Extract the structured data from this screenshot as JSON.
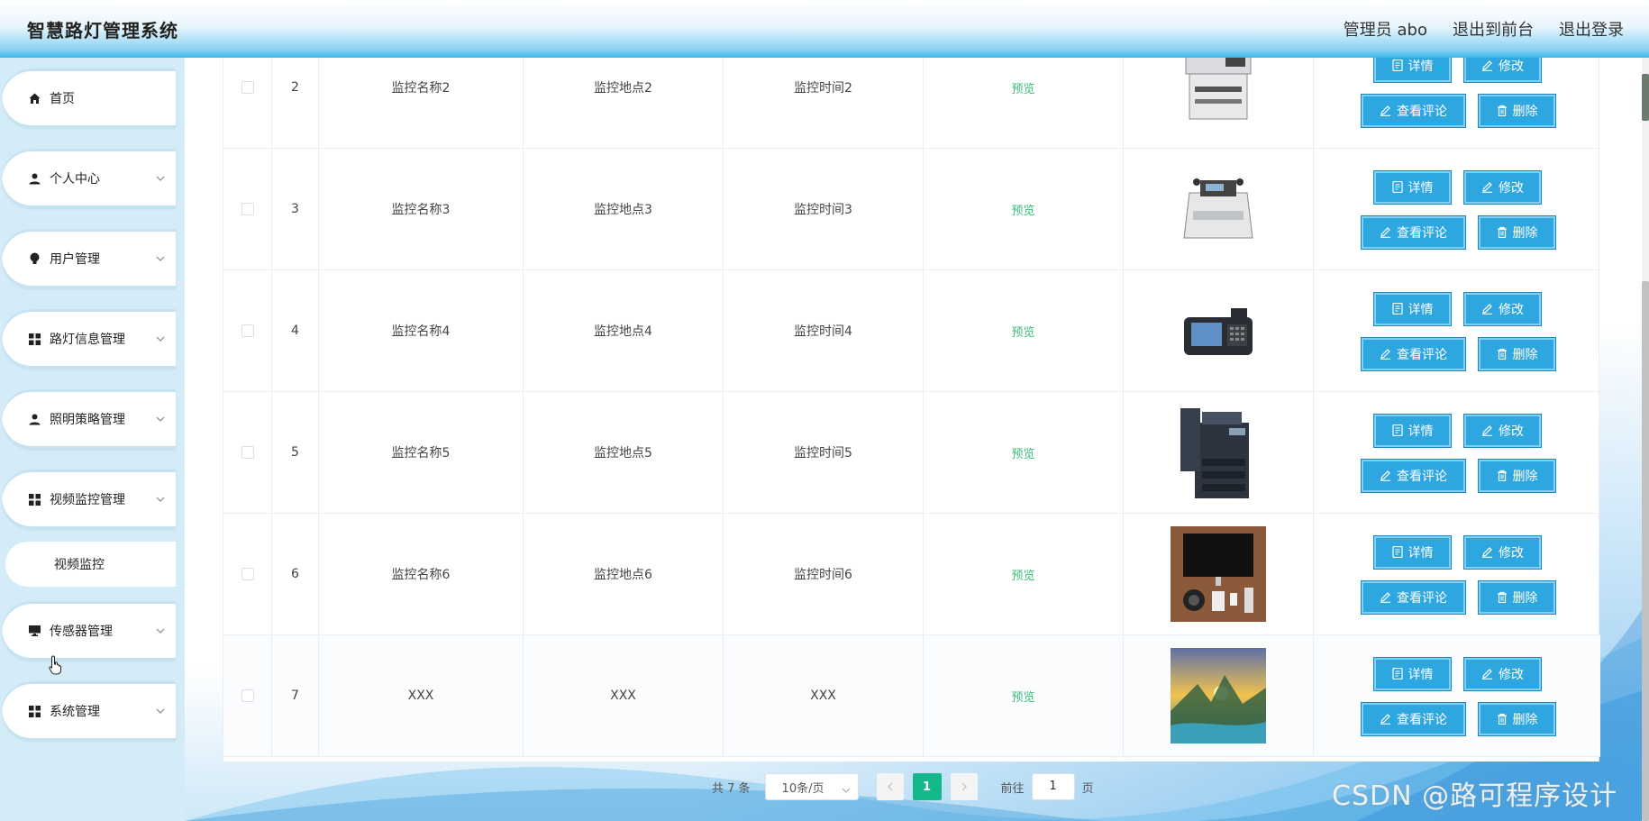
{
  "header": {
    "title": "智慧路灯管理系统",
    "admin_label": "管理员 abo",
    "to_front": "退出到前台",
    "logout": "退出登录"
  },
  "sidebar": {
    "items": [
      {
        "label": "首页",
        "icon": "home-icon",
        "has_chevron": false
      },
      {
        "label": "个人中心",
        "icon": "user-icon",
        "has_chevron": true
      },
      {
        "label": "用户管理",
        "icon": "bulb-icon",
        "has_chevron": true
      },
      {
        "label": "路灯信息管理",
        "icon": "grid-icon",
        "has_chevron": true
      },
      {
        "label": "照明策略管理",
        "icon": "user-icon",
        "has_chevron": true
      },
      {
        "label": "视频监控管理",
        "icon": "grid-icon",
        "has_chevron": true
      },
      {
        "label": "传感器管理",
        "icon": "monitor-icon",
        "has_chevron": true
      },
      {
        "label": "系统管理",
        "icon": "grid-icon",
        "has_chevron": true
      }
    ],
    "submenu_active": "视频监控"
  },
  "table": {
    "preview_text": "预览",
    "actions": {
      "detail": "详情",
      "edit": "修改",
      "comments": "查看评论",
      "delete": "删除"
    },
    "rows": [
      {
        "index": "2",
        "name": "监控名称2",
        "location": "监控地点2",
        "time": "监控时间2",
        "image": "printer-small"
      },
      {
        "index": "3",
        "name": "监控名称3",
        "location": "监控地点3",
        "time": "监控时间3",
        "image": "money-counter"
      },
      {
        "index": "4",
        "name": "监控名称4",
        "location": "监控地点4",
        "time": "监控时间4",
        "image": "pos-terminal"
      },
      {
        "index": "5",
        "name": "监控名称5",
        "location": "监控地点5",
        "time": "监控时间5",
        "image": "printer-large"
      },
      {
        "index": "6",
        "name": "监控名称6",
        "location": "监控地点6",
        "time": "监控时间6",
        "image": "desk-photo"
      },
      {
        "index": "7",
        "name": "XXX",
        "location": "XXX",
        "time": "XXX",
        "image": "landscape-photo"
      }
    ]
  },
  "pagination": {
    "total": "共 7 条",
    "page_size": "10条/页",
    "current_page": "1",
    "goto_prefix": "前往",
    "goto_value": "1",
    "goto_suffix": "页"
  },
  "watermark": "CSDN @路可程序设计",
  "colors": {
    "accent": "#2ea7e0",
    "preview": "#3bbf7a",
    "page_active": "#15b88a"
  }
}
